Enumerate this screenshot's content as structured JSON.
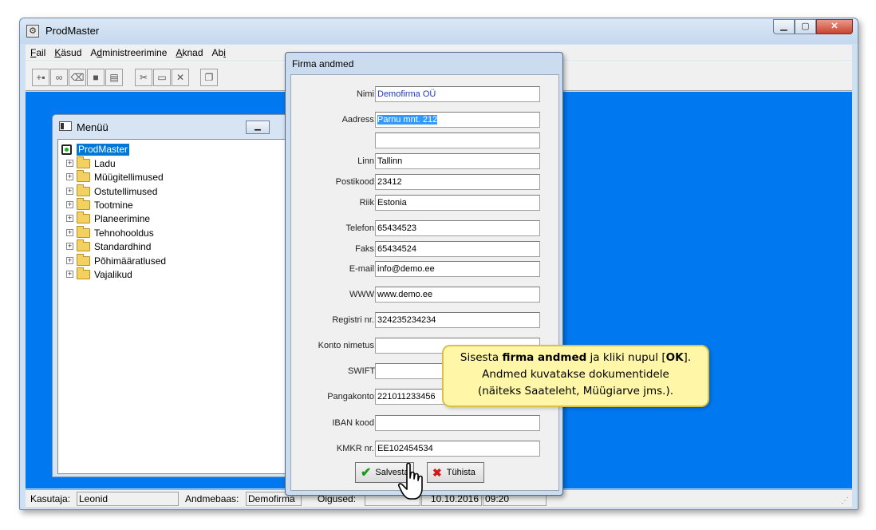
{
  "window": {
    "title": "ProdMaster"
  },
  "menu": [
    "Fail",
    "Käsud",
    "Administreerimine",
    "Aknad",
    "Abi"
  ],
  "toolbar_icons": [
    "new-record-icon",
    "binoculars-icon",
    "eraser-icon",
    "stop-icon",
    "print-icon",
    "cut-icon",
    "folder-icon",
    "delete-icon",
    "copy-icon"
  ],
  "menu_window": {
    "title": "Menüü",
    "root": "ProdMaster",
    "items": [
      "Ladu",
      "Müügitellimused",
      "Ostutellimused",
      "Tootmine",
      "Planeerimine",
      "Tehnohooldus",
      "Standardhind",
      "Põhimääratlused",
      "Vajalikud"
    ]
  },
  "dialog": {
    "title": "Firma andmed",
    "fields": [
      {
        "label": "Nimi:",
        "value": "Demofirma OÜ"
      },
      {
        "label": "Aadress:",
        "value": "Parnu mnt. 212"
      },
      {
        "label": "",
        "value": ""
      },
      {
        "label": "Linn:",
        "value": "Tallinn"
      },
      {
        "label": "Postikood:",
        "value": "23412"
      },
      {
        "label": "Riik:",
        "value": "Estonia"
      },
      {
        "label": "Telefon:",
        "value": "65434523"
      },
      {
        "label": "Faks:",
        "value": "65434524"
      },
      {
        "label": "E-mail:",
        "value": "info@demo.ee"
      },
      {
        "label": "WWW:",
        "value": "www.demo.ee"
      },
      {
        "label": "Registri nr.:",
        "value": "324235234234"
      },
      {
        "label": "Konto nimetus:",
        "value": ""
      },
      {
        "label": "SWIFT:",
        "value": ""
      },
      {
        "label": "Pangakonto:",
        "value": "221011233456"
      },
      {
        "label": "IBAN kood:",
        "value": ""
      },
      {
        "label": "KMKR nr.:",
        "value": "EE102454534"
      }
    ],
    "save_label": "Salvesta",
    "cancel_label": "Tühista"
  },
  "tooltip": {
    "line1_pre": "Sisesta ",
    "line1_bold": "firma andmed",
    "line1_mid": " ja kliki nupul [",
    "line1_ok": "OK",
    "line1_end": "].",
    "line2": "Andmed  kuvatakse dokumentidele",
    "line3": "(näiteks Saateleht, Müügiarve jms.)."
  },
  "status": {
    "user_label": "Kasutaja:",
    "user": "Leonid",
    "db_label": "Andmebaas:",
    "db": "Demofirma",
    "rights_label": "Õigused:",
    "date": "10.10.2016",
    "time": "09:20"
  },
  "colors": {
    "mdi_background": "#0078f0",
    "tooltip_bg": "#fff6a8",
    "selection": "#0078d7"
  }
}
